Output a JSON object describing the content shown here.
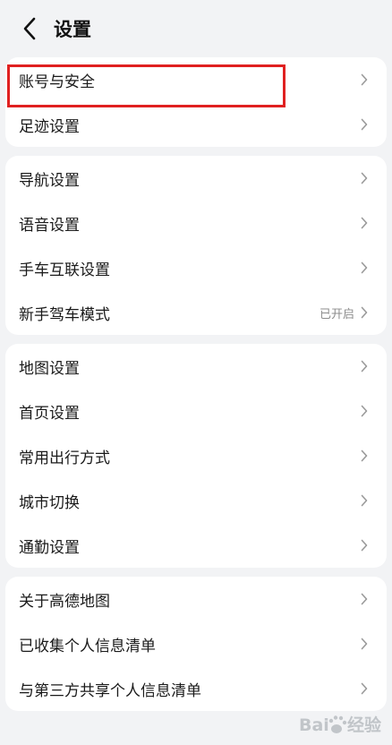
{
  "header": {
    "title": "设置",
    "back_icon": "chevron-left-icon"
  },
  "groups": [
    {
      "items": [
        {
          "label": "账号与安全",
          "highlighted": true
        },
        {
          "label": "足迹设置"
        }
      ]
    },
    {
      "items": [
        {
          "label": "导航设置"
        },
        {
          "label": "语音设置"
        },
        {
          "label": "手车互联设置"
        },
        {
          "label": "新手驾车模式",
          "status": "已开启"
        }
      ]
    },
    {
      "items": [
        {
          "label": "地图设置"
        },
        {
          "label": "首页设置"
        },
        {
          "label": "常用出行方式"
        },
        {
          "label": "城市切换"
        },
        {
          "label": "通勤设置"
        }
      ]
    },
    {
      "items": [
        {
          "label": "关于高德地图"
        },
        {
          "label": "已收集个人信息清单"
        },
        {
          "label": "与第三方共享个人信息清单"
        }
      ]
    }
  ],
  "annotation": {
    "highlight_color": "#e02020"
  },
  "watermark": {
    "text": "Baidu经验",
    "color": "#9aa0a6"
  }
}
